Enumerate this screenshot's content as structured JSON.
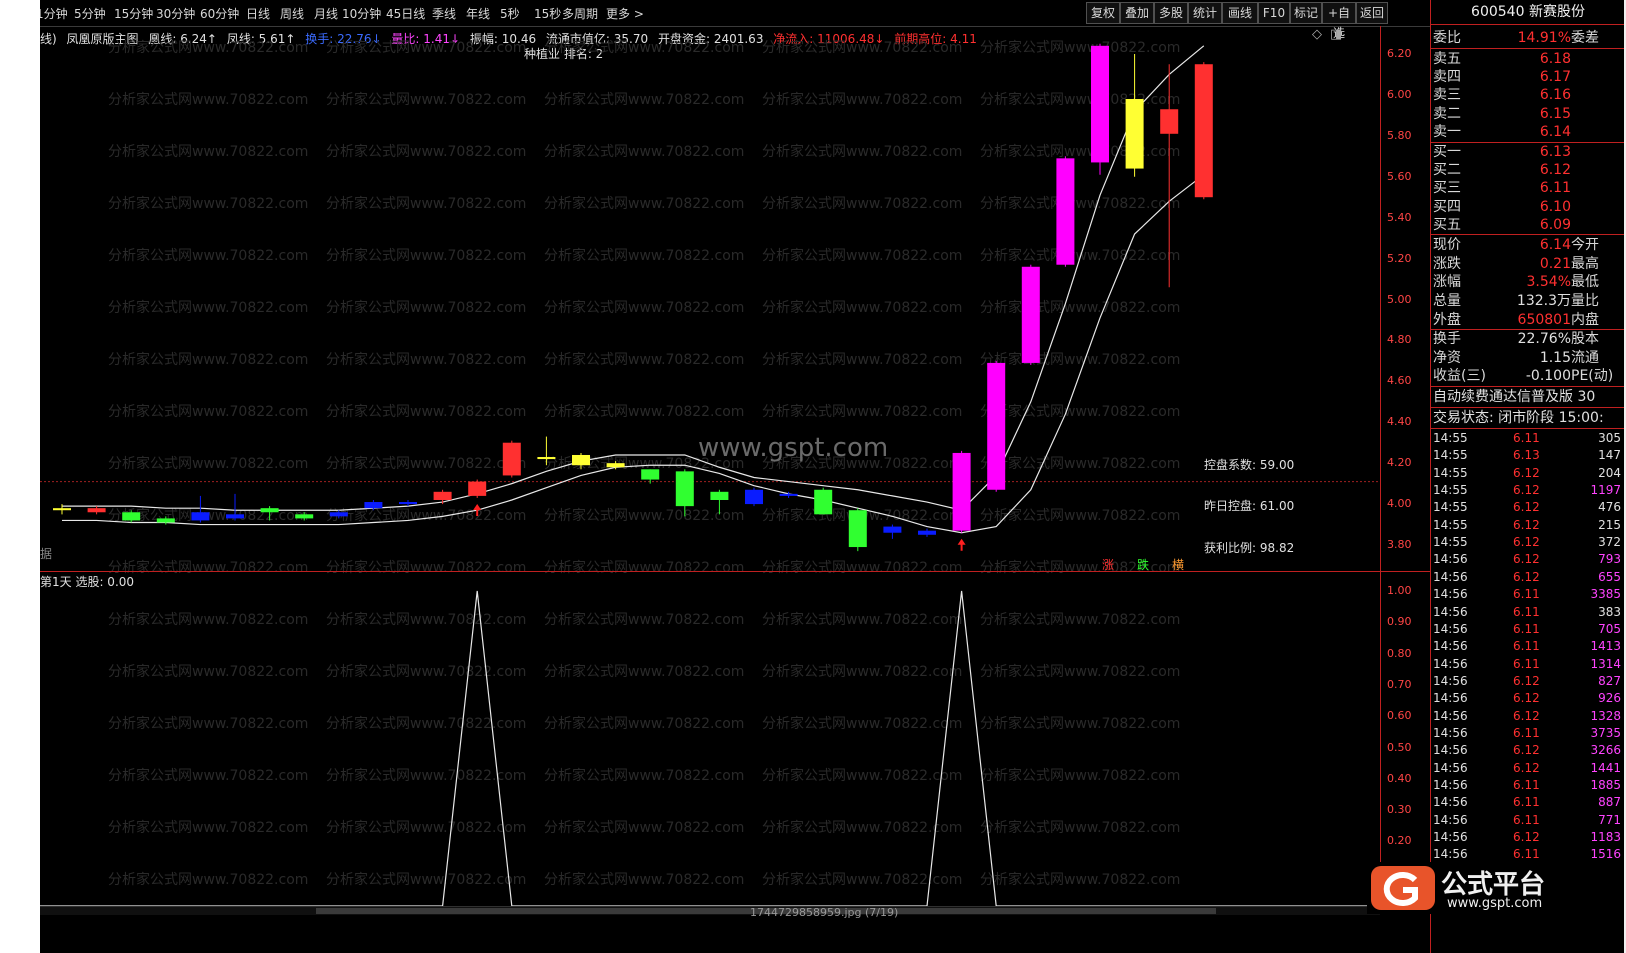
{
  "toolbar": {
    "periods": [
      "1分钟",
      "5分钟",
      "15分钟",
      "30分钟",
      "60分钟",
      "日线",
      "周线",
      "月线",
      "10分钟",
      "45日线",
      "季线",
      "年线",
      "5秒",
      "15秒",
      "多周期",
      "更多 >"
    ],
    "buttons": [
      "复权",
      "叠加",
      "多股",
      "统计",
      "画线",
      "F10",
      "标记",
      "+自选",
      "返回"
    ]
  },
  "indicator": {
    "prefix": "线)",
    "name": "凤凰原版主图",
    "huang_label": "凰线: 6.24↑",
    "feng_label": "凤线: 5.61↑",
    "turnover_label": "换手: 22.76↓",
    "volratio_label": "量比: 1.41↓",
    "amplitude_label": "振幅: 10.46",
    "float_mcap_label": "流通市值亿: 35.70",
    "open_fund_label": "开盘资金: 2401.63",
    "net_inflow_label": "净流入: 11006.48↓",
    "prev_high_label": "前期高位: 4.11",
    "industry_rank": "种植业 排名: 2"
  },
  "main_chart": {
    "site_watermark": "www.gspt.com",
    "control_coef": "控盘系数: 59.00",
    "prev_control": "昨日控盘: 61.00",
    "profit_ratio": "获利比例: 98.82",
    "legend_up": "涨",
    "legend_down": "跌",
    "legend_flat": "横",
    "side_label": "据",
    "y_ticks": [
      "6.20",
      "6.00",
      "5.80",
      "5.60",
      "5.40",
      "5.20",
      "5.00",
      "4.80",
      "4.60",
      "4.40",
      "4.20",
      "4.00",
      "3.80"
    ]
  },
  "sub_chart": {
    "title": "第1天  选股: 0.00",
    "y_ticks": [
      "1.00",
      "0.90",
      "0.80",
      "0.70",
      "0.60",
      "0.50",
      "0.40",
      "0.30",
      "0.20"
    ]
  },
  "watermark_text": "分析家公式网www.70822.com",
  "footer_file": "1744729858959.jpg (7/19)",
  "right_panel": {
    "title": "600540 新赛股份",
    "weibi": {
      "label": "委比",
      "value": "14.91%",
      "tail": "委差"
    },
    "asks": [
      {
        "label": "卖五",
        "price": "6.18"
      },
      {
        "label": "卖四",
        "price": "6.17"
      },
      {
        "label": "卖三",
        "price": "6.16"
      },
      {
        "label": "卖二",
        "price": "6.15"
      },
      {
        "label": "卖一",
        "price": "6.14"
      }
    ],
    "bids": [
      {
        "label": "买一",
        "price": "6.13"
      },
      {
        "label": "买二",
        "price": "6.12"
      },
      {
        "label": "买三",
        "price": "6.11"
      },
      {
        "label": "买四",
        "price": "6.10"
      },
      {
        "label": "买五",
        "price": "6.09"
      }
    ],
    "quote": [
      {
        "label": "现价",
        "value": "6.14",
        "tail": "今开",
        "color": "#ff3030"
      },
      {
        "label": "涨跌",
        "value": "0.21",
        "tail": "最高",
        "color": "#ff3030"
      },
      {
        "label": "涨幅",
        "value": "3.54%",
        "tail": "最低",
        "color": "#ff3030"
      },
      {
        "label": "总量",
        "value": "132.3万",
        "tail": "量比",
        "color": "#e0e0e0"
      },
      {
        "label": "外盘",
        "value": "650801",
        "tail": "内盘",
        "color": "#ff3030"
      }
    ],
    "quote2": [
      {
        "label": "换手",
        "value": "22.76%",
        "tail": "股本",
        "color": "#e0e0e0"
      },
      {
        "label": "净资",
        "value": "1.15",
        "tail": "流通",
        "color": "#e0e0e0"
      },
      {
        "label": "收益(三)",
        "value": "-0.100",
        "tail": "PE(动)",
        "color": "#e0e0e0"
      }
    ],
    "notice": "自动续费通达信普及版 30",
    "status": "交易状态: 闭市阶段 15:00:",
    "ticks": [
      {
        "t": "14:55",
        "p": "6.11",
        "v": "305",
        "pc": "#ff3030",
        "vc": "#e0e0e0"
      },
      {
        "t": "14:55",
        "p": "6.13",
        "v": "147",
        "pc": "#ff3030",
        "vc": "#e0e0e0"
      },
      {
        "t": "14:55",
        "p": "6.12",
        "v": "204",
        "pc": "#ff3030",
        "vc": "#e0e0e0"
      },
      {
        "t": "14:55",
        "p": "6.12",
        "v": "1197",
        "pc": "#ff3030",
        "vc": "#ff44ff"
      },
      {
        "t": "14:55",
        "p": "6.12",
        "v": "476",
        "pc": "#ff3030",
        "vc": "#e0e0e0"
      },
      {
        "t": "14:55",
        "p": "6.12",
        "v": "215",
        "pc": "#ff3030",
        "vc": "#e0e0e0"
      },
      {
        "t": "14:55",
        "p": "6.12",
        "v": "372",
        "pc": "#ff3030",
        "vc": "#e0e0e0"
      },
      {
        "t": "14:56",
        "p": "6.12",
        "v": "793",
        "pc": "#ff3030",
        "vc": "#ff44ff"
      },
      {
        "t": "14:56",
        "p": "6.12",
        "v": "655",
        "pc": "#ff3030",
        "vc": "#ff44ff"
      },
      {
        "t": "14:56",
        "p": "6.11",
        "v": "3385",
        "pc": "#ff3030",
        "vc": "#ff44ff"
      },
      {
        "t": "14:56",
        "p": "6.11",
        "v": "383",
        "pc": "#ff3030",
        "vc": "#e0e0e0"
      },
      {
        "t": "14:56",
        "p": "6.11",
        "v": "705",
        "pc": "#ff3030",
        "vc": "#ff44ff"
      },
      {
        "t": "14:56",
        "p": "6.11",
        "v": "1413",
        "pc": "#ff3030",
        "vc": "#ff44ff"
      },
      {
        "t": "14:56",
        "p": "6.11",
        "v": "1314",
        "pc": "#ff3030",
        "vc": "#ff44ff"
      },
      {
        "t": "14:56",
        "p": "6.12",
        "v": "827",
        "pc": "#ff3030",
        "vc": "#ff44ff"
      },
      {
        "t": "14:56",
        "p": "6.12",
        "v": "926",
        "pc": "#ff3030",
        "vc": "#ff44ff"
      },
      {
        "t": "14:56",
        "p": "6.12",
        "v": "1328",
        "pc": "#ff3030",
        "vc": "#ff44ff"
      },
      {
        "t": "14:56",
        "p": "6.11",
        "v": "3735",
        "pc": "#ff3030",
        "vc": "#ff44ff"
      },
      {
        "t": "14:56",
        "p": "6.12",
        "v": "3266",
        "pc": "#ff3030",
        "vc": "#ff44ff"
      },
      {
        "t": "14:56",
        "p": "6.12",
        "v": "1441",
        "pc": "#ff3030",
        "vc": "#ff44ff"
      },
      {
        "t": "14:56",
        "p": "6.11",
        "v": "1885",
        "pc": "#ff3030",
        "vc": "#ff44ff"
      },
      {
        "t": "14:56",
        "p": "6.11",
        "v": "887",
        "pc": "#ff3030",
        "vc": "#ff44ff"
      },
      {
        "t": "14:56",
        "p": "6.11",
        "v": "771",
        "pc": "#ff3030",
        "vc": "#ff44ff"
      },
      {
        "t": "14:56",
        "p": "6.12",
        "v": "1183",
        "pc": "#ff3030",
        "vc": "#ff44ff"
      },
      {
        "t": "14:56",
        "p": "6.11",
        "v": "1516",
        "pc": "#ff3030",
        "vc": "#ff44ff"
      }
    ]
  },
  "logo": {
    "name": "公式平台",
    "url": "www.gspt.com"
  },
  "chart_data": {
    "type": "candlestick",
    "price_range": [
      3.8,
      6.2
    ],
    "candles": [
      {
        "o": 3.97,
        "c": 3.98,
        "h": 4.0,
        "l": 3.95,
        "color": "#ffff33"
      },
      {
        "o": 3.98,
        "c": 3.96,
        "h": 3.99,
        "l": 3.95,
        "color": "#ff3030"
      },
      {
        "o": 3.96,
        "c": 3.92,
        "h": 3.97,
        "l": 3.91,
        "color": "#30ff30"
      },
      {
        "o": 3.93,
        "c": 3.91,
        "h": 3.94,
        "l": 3.9,
        "color": "#30ff30"
      },
      {
        "o": 3.96,
        "c": 3.92,
        "h": 4.04,
        "l": 3.91,
        "color": "#0a1cff"
      },
      {
        "o": 3.93,
        "c": 3.95,
        "h": 4.05,
        "l": 3.92,
        "color": "#0a1cff"
      },
      {
        "o": 3.98,
        "c": 3.96,
        "h": 3.99,
        "l": 3.92,
        "color": "#30ff30"
      },
      {
        "o": 3.95,
        "c": 3.93,
        "h": 3.96,
        "l": 3.92,
        "color": "#30ff30"
      },
      {
        "o": 3.94,
        "c": 3.96,
        "h": 3.97,
        "l": 3.93,
        "color": "#0a1cff"
      },
      {
        "o": 3.98,
        "c": 4.01,
        "h": 4.02,
        "l": 3.97,
        "color": "#0a1cff"
      },
      {
        "o": 4.0,
        "c": 4.01,
        "h": 4.02,
        "l": 3.99,
        "color": "#0a1cff"
      },
      {
        "o": 4.02,
        "c": 4.06,
        "h": 4.07,
        "l": 4.0,
        "color": "#ff3030"
      },
      {
        "o": 4.04,
        "c": 4.11,
        "h": 4.12,
        "l": 4.03,
        "color": "#ff3030"
      },
      {
        "o": 4.14,
        "c": 4.3,
        "h": 4.31,
        "l": 4.13,
        "color": "#ff3030"
      },
      {
        "o": 4.22,
        "c": 4.23,
        "h": 4.33,
        "l": 4.19,
        "color": "#ffff33"
      },
      {
        "o": 4.24,
        "c": 4.19,
        "h": 4.25,
        "l": 4.17,
        "color": "#ffff33"
      },
      {
        "o": 4.2,
        "c": 4.18,
        "h": 4.21,
        "l": 4.17,
        "color": "#ffff33"
      },
      {
        "o": 4.17,
        "c": 4.12,
        "h": 4.17,
        "l": 4.1,
        "color": "#30ff30"
      },
      {
        "o": 4.16,
        "c": 3.99,
        "h": 4.17,
        "l": 3.94,
        "color": "#30ff30"
      },
      {
        "o": 4.06,
        "c": 4.02,
        "h": 4.07,
        "l": 3.95,
        "color": "#30ff30"
      },
      {
        "o": 4.07,
        "c": 4.0,
        "h": 4.08,
        "l": 3.99,
        "color": "#0a1cff"
      },
      {
        "o": 4.05,
        "c": 4.04,
        "h": 4.06,
        "l": 4.03,
        "color": "#0a1cff"
      },
      {
        "o": 4.07,
        "c": 3.95,
        "h": 4.08,
        "l": 3.95,
        "color": "#30ff30"
      },
      {
        "o": 3.97,
        "c": 3.79,
        "h": 3.98,
        "l": 3.77,
        "color": "#30ff30"
      },
      {
        "o": 3.89,
        "c": 3.86,
        "h": 3.9,
        "l": 3.83,
        "color": "#0a1cff"
      },
      {
        "o": 3.87,
        "c": 3.85,
        "h": 3.88,
        "l": 3.84,
        "color": "#0a1cff"
      },
      {
        "o": 3.87,
        "c": 4.25,
        "h": 4.26,
        "l": 3.86,
        "color": "#ff00ff"
      },
      {
        "o": 4.07,
        "c": 4.69,
        "h": 4.7,
        "l": 4.06,
        "color": "#ff00ff"
      },
      {
        "o": 4.69,
        "c": 5.16,
        "h": 5.17,
        "l": 4.68,
        "color": "#ff00ff"
      },
      {
        "o": 5.17,
        "c": 5.69,
        "h": 5.7,
        "l": 5.16,
        "color": "#ff00ff"
      },
      {
        "o": 5.67,
        "c": 6.24,
        "h": 6.25,
        "l": 5.61,
        "color": "#ff00ff"
      },
      {
        "o": 5.98,
        "c": 5.64,
        "h": 6.2,
        "l": 5.6,
        "color": "#ffff33"
      },
      {
        "o": 5.93,
        "c": 5.81,
        "h": 6.15,
        "l": 5.06,
        "color": "#ff3030"
      },
      {
        "o": 6.15,
        "c": 5.5,
        "h": 6.16,
        "l": 5.49,
        "color": "#ff3030"
      }
    ],
    "huang_line": [
      3.99,
      3.99,
      3.99,
      3.98,
      3.98,
      3.97,
      3.97,
      3.97,
      3.97,
      3.98,
      3.99,
      4.01,
      4.05,
      4.1,
      4.16,
      4.21,
      4.24,
      4.24,
      4.24,
      4.18,
      4.13,
      4.11,
      4.09,
      4.07,
      4.04,
      4.01,
      3.97,
      4.14,
      4.5,
      4.98,
      5.51,
      5.92,
      6.1,
      6.24
    ],
    "feng_line": [
      3.92,
      3.92,
      3.91,
      3.91,
      3.9,
      3.9,
      3.9,
      3.9,
      3.9,
      3.91,
      3.92,
      3.94,
      3.97,
      4.02,
      4.08,
      4.14,
      4.18,
      4.19,
      4.19,
      4.15,
      4.09,
      4.05,
      4.02,
      3.98,
      3.94,
      3.89,
      3.86,
      3.89,
      4.07,
      4.44,
      4.91,
      5.32,
      5.48,
      5.61
    ],
    "ref_line": 4.11,
    "select_signal": [
      0,
      0,
      0,
      0,
      0,
      0,
      0,
      0,
      0,
      0,
      0,
      0,
      1,
      0,
      0,
      0,
      0,
      0,
      0,
      0,
      0,
      0,
      0,
      0,
      0,
      0,
      1,
      0,
      0,
      0,
      0,
      0,
      0,
      0
    ]
  }
}
